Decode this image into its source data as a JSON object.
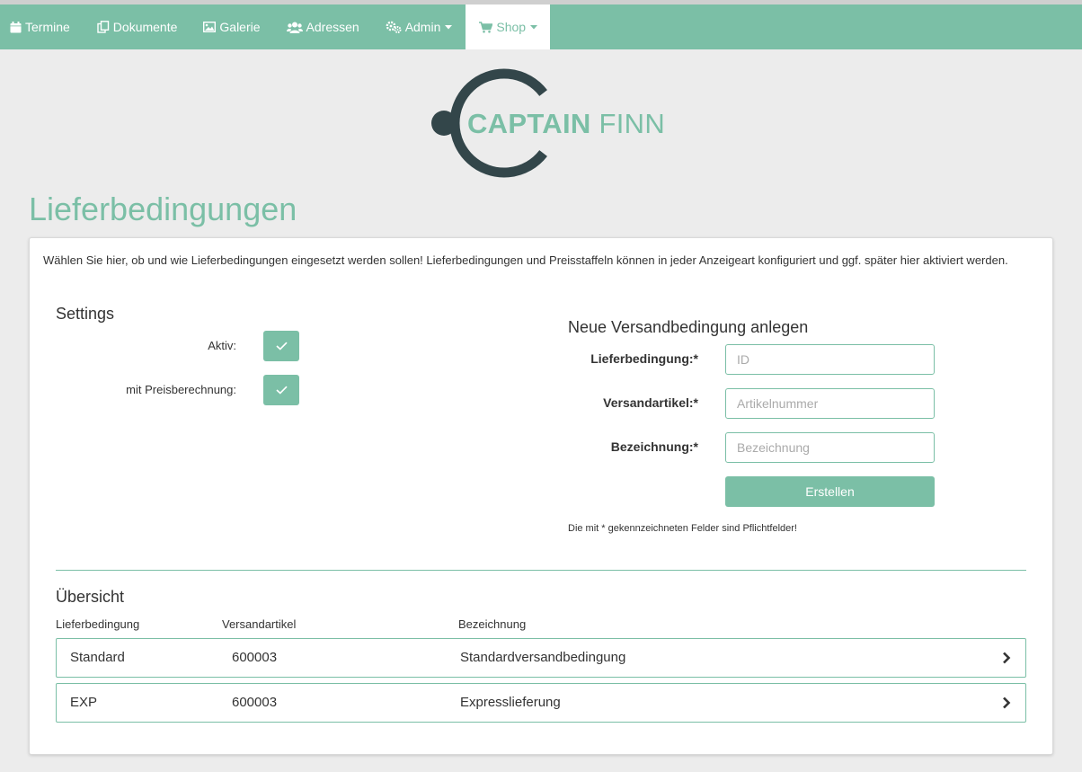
{
  "nav": {
    "items": [
      {
        "label": "Termine",
        "icon": "calendar-icon"
      },
      {
        "label": "Dokumente",
        "icon": "documents-icon"
      },
      {
        "label": "Galerie",
        "icon": "image-icon"
      },
      {
        "label": "Adressen",
        "icon": "users-icon"
      },
      {
        "label": "Admin",
        "icon": "cogs-icon",
        "dropdown": true
      },
      {
        "label": "Shop",
        "icon": "cart-icon",
        "dropdown": true,
        "active": true
      }
    ]
  },
  "logo": {
    "word1": "CAPTAIN",
    "word2": "FINN"
  },
  "page": {
    "title": "Lieferbedingungen"
  },
  "intro": "Wählen Sie hier, ob und wie Lieferbedingungen eingesetzt werden sollen! Lieferbedingungen und Preisstaffeln können in jeder Anzeigeart konfiguriert und ggf. später hier aktiviert werden.",
  "settings": {
    "title": "Settings",
    "active_label": "Aktiv:",
    "active_checked": true,
    "pricing_label": "mit Preisberechnung:",
    "pricing_checked": true
  },
  "new_condition": {
    "title": "Neue Versandbedingung anlegen",
    "fields": [
      {
        "label": "Lieferbedingung:*",
        "placeholder": "ID",
        "value": ""
      },
      {
        "label": "Versandartikel:*",
        "placeholder": "Artikelnummer",
        "value": ""
      },
      {
        "label": "Bezeichnung:*",
        "placeholder": "Bezeichnung",
        "value": ""
      }
    ],
    "submit_label": "Erstellen",
    "hint": "Die mit * gekennzeichneten Felder sind Pflichtfelder!"
  },
  "overview": {
    "title": "Übersicht",
    "columns": [
      "Lieferbedingung",
      "Versandartikel",
      "Bezeichnung"
    ],
    "rows": [
      {
        "code": "Standard",
        "article": "600003",
        "name": "Standardversandbedingung"
      },
      {
        "code": "EXP",
        "article": "600003",
        "name": "Expresslieferung"
      }
    ]
  },
  "colors": {
    "accent": "#7bbfa6",
    "logo_dark": "#33464a",
    "background": "#ececec"
  }
}
